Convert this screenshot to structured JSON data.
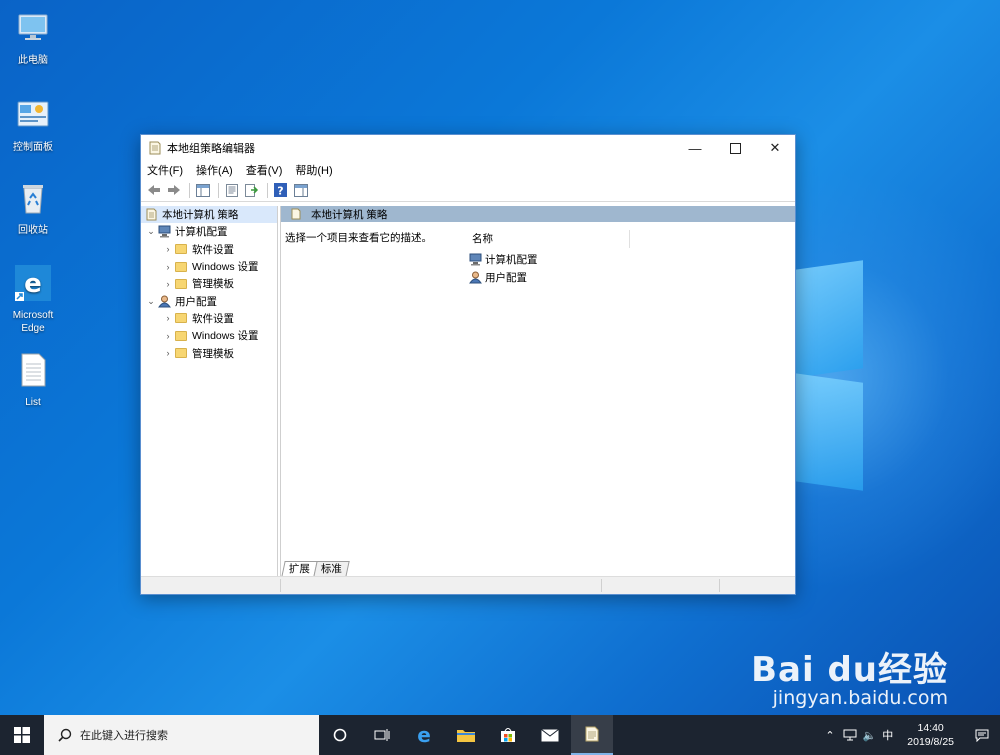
{
  "desktop": {
    "icons": [
      {
        "label": "此电脑",
        "icon": "this-pc-icon"
      },
      {
        "label": "控制面板",
        "icon": "control-panel-icon"
      },
      {
        "label": "回收站",
        "icon": "recycle-bin-icon"
      },
      {
        "label": "Microsoft Edge",
        "icon": "edge-icon"
      },
      {
        "label": "List",
        "icon": "text-file-icon"
      }
    ]
  },
  "window": {
    "title": "本地组策略编辑器",
    "menu": [
      "文件(F)",
      "操作(A)",
      "查看(V)",
      "帮助(H)"
    ],
    "tree": [
      {
        "label": "本地计算机 策略",
        "level": 0,
        "icon": "policy-icon",
        "selected": true
      },
      {
        "label": "计算机配置",
        "level": 1,
        "icon": "computer-config-icon",
        "expanded": true
      },
      {
        "label": "软件设置",
        "level": 2,
        "icon": "folder-icon"
      },
      {
        "label": "Windows 设置",
        "level": 2,
        "icon": "folder-icon"
      },
      {
        "label": "管理模板",
        "level": 2,
        "icon": "folder-icon"
      },
      {
        "label": "用户配置",
        "level": 1,
        "icon": "user-config-icon",
        "expanded": true
      },
      {
        "label": "软件设置",
        "level": 2,
        "icon": "folder-icon"
      },
      {
        "label": "Windows 设置",
        "level": 2,
        "icon": "folder-icon"
      },
      {
        "label": "管理模板",
        "level": 2,
        "icon": "folder-icon"
      }
    ],
    "right": {
      "header": "本地计算机 策略",
      "description": "选择一个项目来查看它的描述。",
      "column": "名称",
      "items": [
        "计算机配置",
        "用户配置"
      ]
    },
    "tabs": [
      "扩展",
      "标准"
    ]
  },
  "taskbar": {
    "search_placeholder": "在此键入进行搜索",
    "ime": "中",
    "time": "14:40",
    "date": "2019/8/25"
  },
  "watermark": {
    "brand": "Bai du经验",
    "url": "jingyan.baidu.com"
  }
}
